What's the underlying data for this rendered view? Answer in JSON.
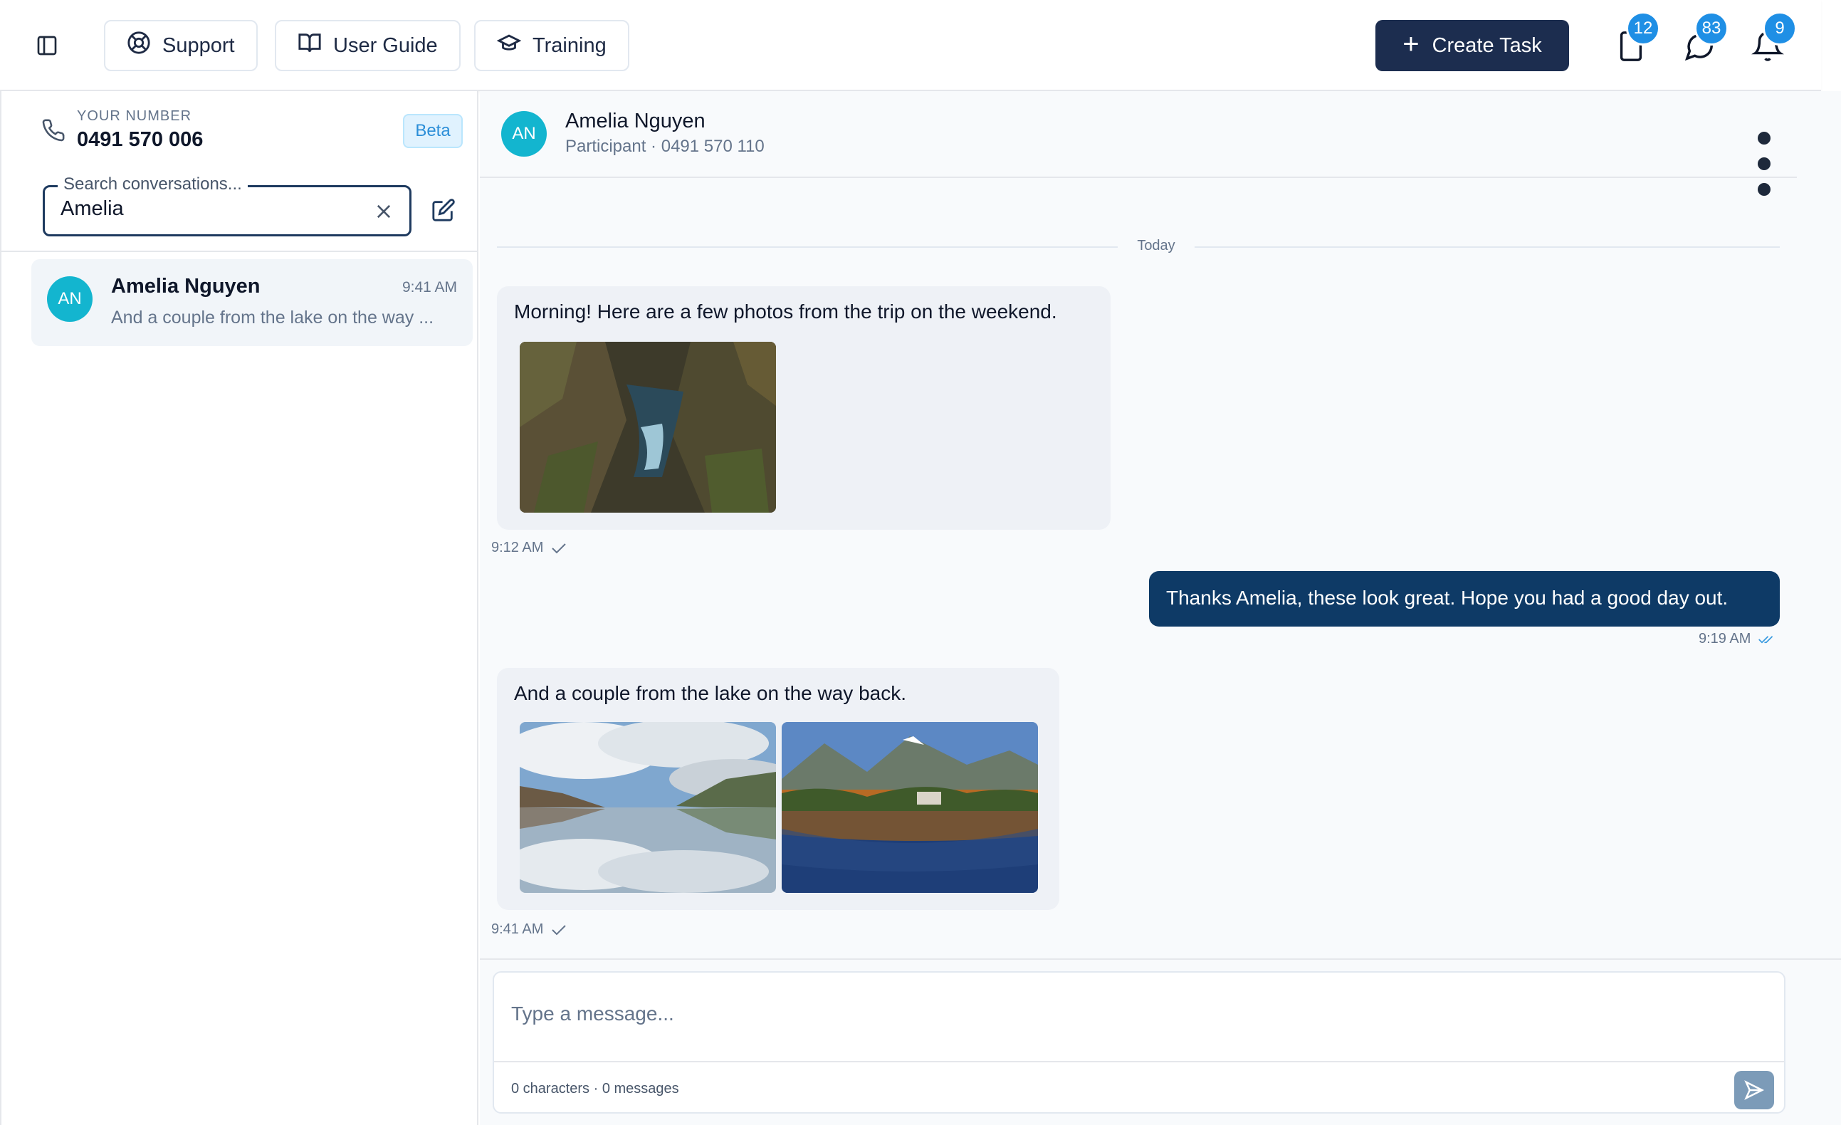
{
  "topbar": {
    "support_label": "Support",
    "user_guide_label": "User Guide",
    "training_label": "Training",
    "create_task_label": "Create Task",
    "device_badge": "12",
    "messages_badge": "83",
    "notifications_badge": "9"
  },
  "sidebar": {
    "your_number_label": "YOUR NUMBER",
    "your_number": "0491 570 006",
    "beta_label": "Beta",
    "search": {
      "legend": "Search conversations...",
      "value": "Amelia"
    },
    "conversations": [
      {
        "initials": "AN",
        "name": "Amelia Nguyen",
        "time": "9:41 AM",
        "preview": "And a couple from the lake on the way ..."
      }
    ]
  },
  "chat": {
    "contact_initials": "AN",
    "contact_name": "Amelia Nguyen",
    "contact_subtitle": "Participant · 0491 570 110",
    "date_divider": "Today",
    "messages": [
      {
        "direction": "incoming",
        "text": "Morning! Here are a few photos from the trip on the weekend.",
        "time": "9:12 AM",
        "status": "sent",
        "images": [
          "canyon-river-photo"
        ]
      },
      {
        "direction": "outgoing",
        "text": "Thanks Amelia, these look great. Hope you had a good day out.",
        "time": "9:19 AM",
        "status": "read"
      },
      {
        "direction": "incoming",
        "text": "And a couple from the lake on the way back.",
        "time": "9:41 AM",
        "status": "sent",
        "images": [
          "cloudy-lake-photo",
          "mountain-lake-photo"
        ]
      }
    ],
    "composer": {
      "placeholder": "Type a message...",
      "count": "0 characters · 0 messages"
    }
  },
  "colors": {
    "primary_navy": "#1c2d4f",
    "outgoing_bubble": "#0e3a66",
    "avatar_teal": "#13b5cf",
    "badge_blue": "#1f8fe5",
    "read_tick": "#3b9be0"
  }
}
